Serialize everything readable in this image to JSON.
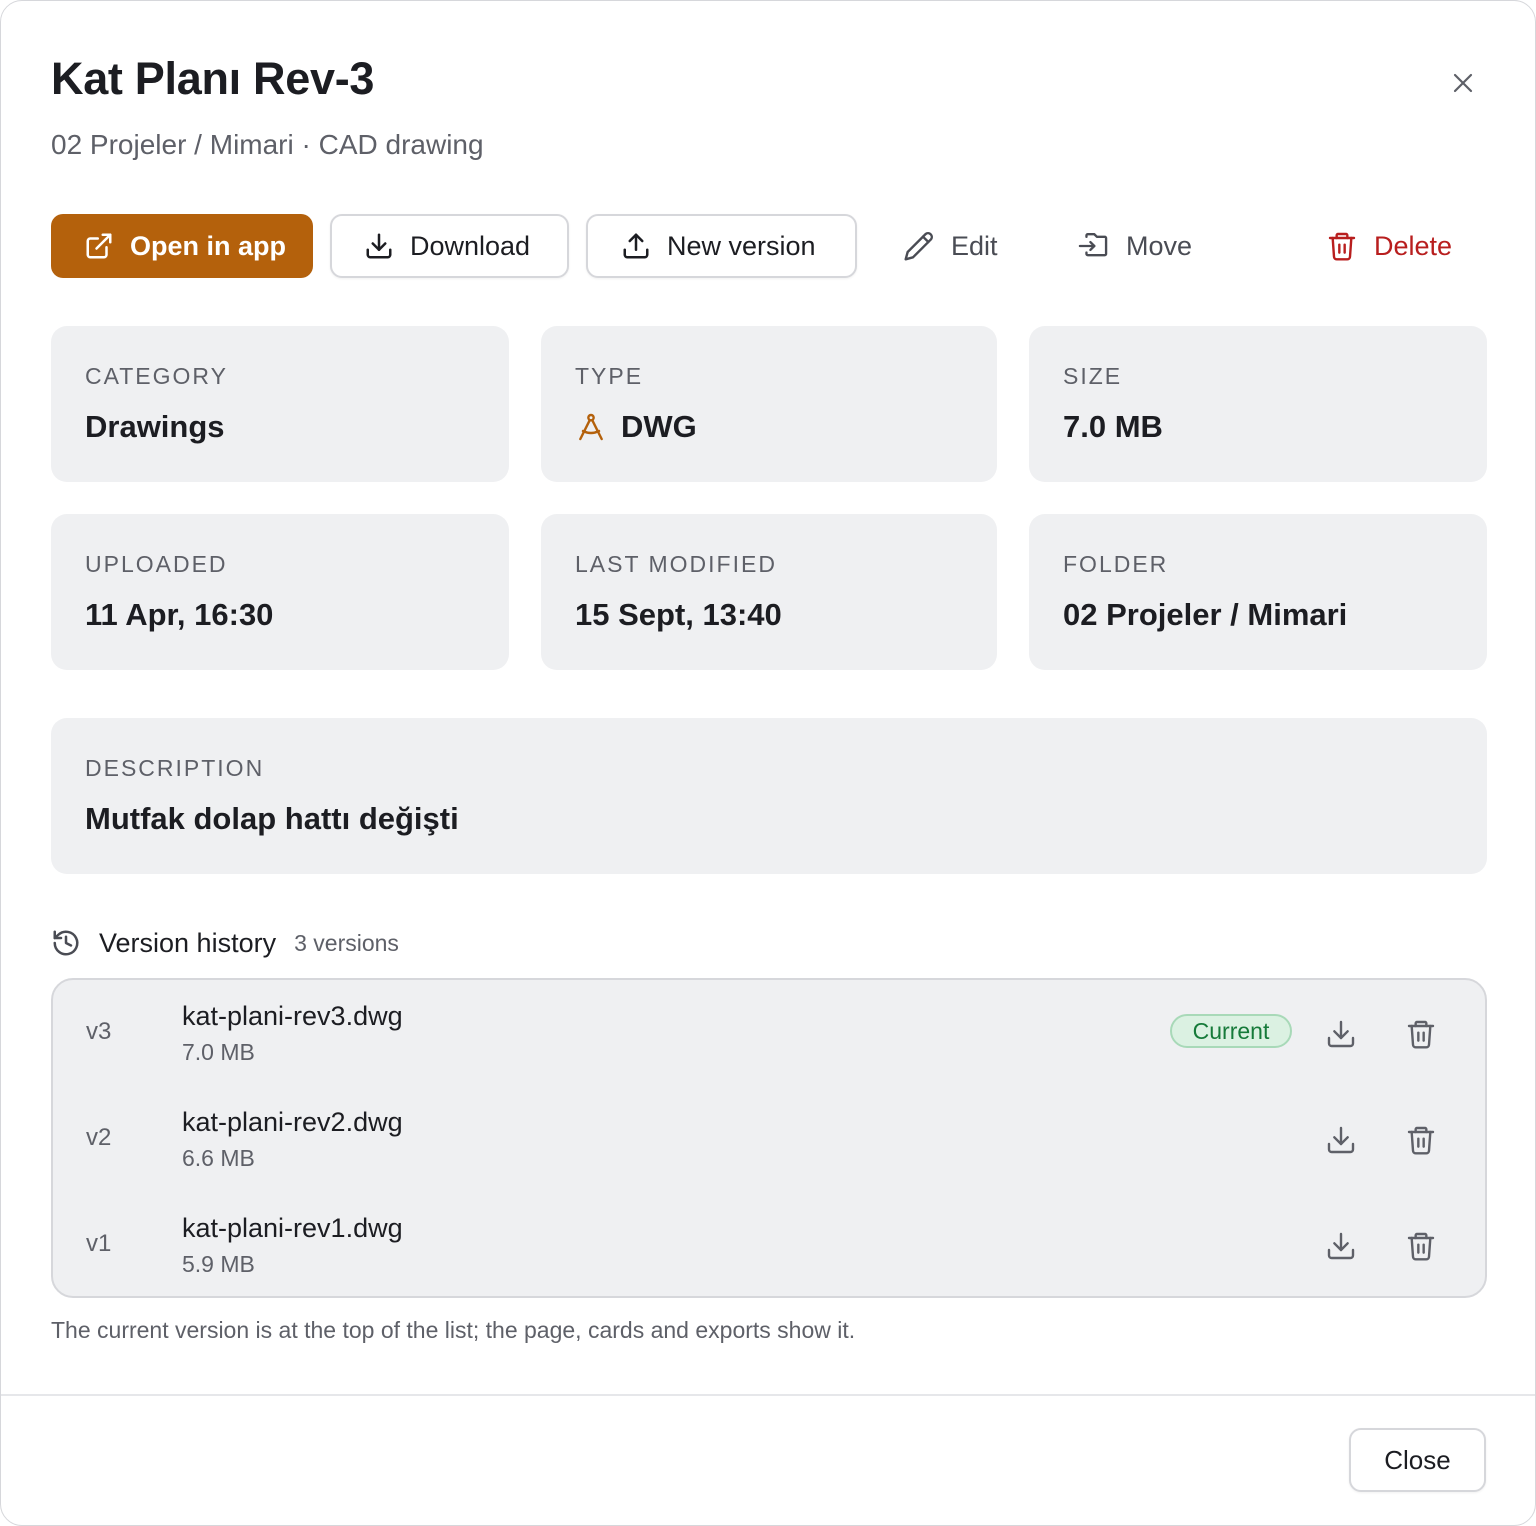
{
  "header": {
    "title": "Kat Planı Rev-3",
    "subtitle": "02 Projeler / Mimari · CAD drawing"
  },
  "toolbar": {
    "open_label": "Open in app",
    "download_label": "Download",
    "new_version_label": "New version",
    "edit_label": "Edit",
    "move_label": "Move",
    "delete_label": "Delete"
  },
  "details": {
    "category": {
      "label": "CATEGORY",
      "value": "Drawings"
    },
    "type": {
      "label": "TYPE",
      "value": "DWG",
      "icon": "drafting-compass-icon"
    },
    "size": {
      "label": "SIZE",
      "value": "7.0 MB"
    },
    "uploaded": {
      "label": "UPLOADED",
      "value": "11 Apr, 16:30"
    },
    "modified": {
      "label": "LAST MODIFIED",
      "value": "15 Sept, 13:40"
    },
    "folder": {
      "label": "FOLDER",
      "value": "02 Projeler / Mimari"
    },
    "description": {
      "label": "DESCRIPTION",
      "value": "Mutfak dolap hattı değişti"
    }
  },
  "version_history": {
    "title": "Version history",
    "count": "3 versions",
    "current_badge": "Current",
    "items": [
      {
        "tag": "v3",
        "name": "kat-plani-rev3.dwg",
        "size": "7.0 MB"
      },
      {
        "tag": "v2",
        "name": "kat-plani-rev2.dwg",
        "size": "6.6 MB"
      },
      {
        "tag": "v1",
        "name": "kat-plani-rev1.dwg",
        "size": "5.9 MB"
      }
    ],
    "footnote": "The current version is at the top of the list; the page, cards and exports show it."
  },
  "footer": {
    "close_label": "Close"
  },
  "colors": {
    "accent": "#b4610c",
    "danger": "#b81e1e",
    "success": "#167a3a",
    "card_bg": "#eff0f2"
  }
}
